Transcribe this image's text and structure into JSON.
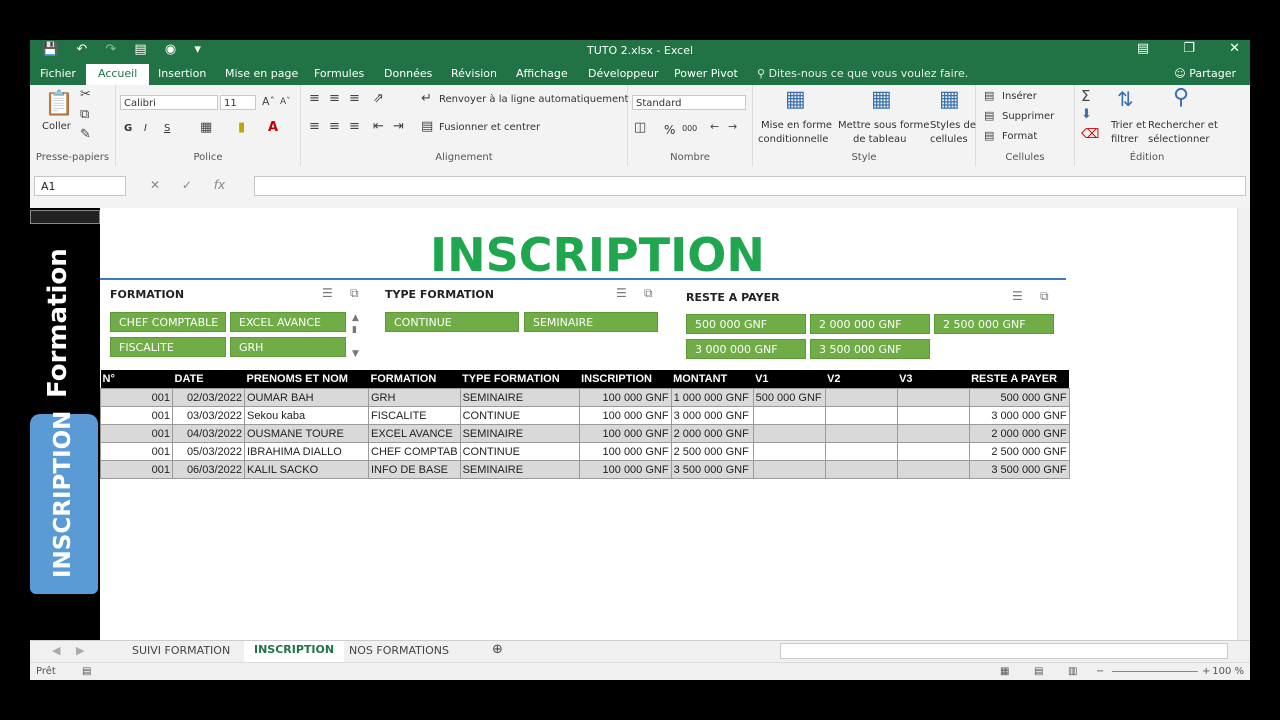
{
  "window": {
    "title": "TUTO 2.xlsx - Excel"
  },
  "ribbon_tabs": [
    "Fichier",
    "Accueil",
    "Insertion",
    "Mise en page",
    "Formules",
    "Données",
    "Révision",
    "Affichage",
    "Développeur",
    "Power Pivot"
  ],
  "tell_me": "Dites-nous ce que vous voulez faire.",
  "share": "Partager",
  "clipboard": {
    "paste": "Coller",
    "label": "Presse-papiers"
  },
  "font": {
    "name": "Calibri",
    "size": "11",
    "bold": "G",
    "italic": "I",
    "underline": "S",
    "label": "Police"
  },
  "alignment": {
    "wrap": "Renvoyer à la ligne automatiquement",
    "merge": "Fusionner et centrer",
    "label": "Alignement"
  },
  "number": {
    "format": "Standard",
    "percent": "%",
    "thousands": "000",
    "label": "Nombre"
  },
  "style": {
    "cond": "Mise en forme",
    "cond2": "conditionnelle",
    "table": "Mettre sous forme",
    "table2": "de tableau",
    "cell": "Styles de",
    "cell2": "cellules",
    "label": "Style"
  },
  "cells": {
    "insert": "Insérer",
    "delete": "Supprimer",
    "format": "Format",
    "label": "Cellules"
  },
  "editing": {
    "sort": "Trier et",
    "sort2": "filtrer",
    "find": "Rechercher et",
    "find2": "sélectionner",
    "label": "Édition"
  },
  "formula_bar": {
    "name_box": "A1",
    "fx": "fx"
  },
  "left_panel": {
    "formation": "Formation",
    "inscription_btn": "INSCRIPTION"
  },
  "sheet_title": "INSCRIPTION",
  "slicers": {
    "formation": {
      "title": "FORMATION",
      "items": [
        "CHEF COMPTABLE",
        "EXCEL AVANCE",
        "FISCALITE",
        "GRH"
      ]
    },
    "type_formation": {
      "title": "TYPE FORMATION",
      "items": [
        "CONTINUE",
        "SEMINAIRE"
      ]
    },
    "reste_a_payer": {
      "title": "RESTE A PAYER",
      "items": [
        "500 000 GNF",
        "2 000 000 GNF",
        "2 500 000 GNF",
        "3 000 000 GNF",
        "3 500 000 GNF"
      ]
    }
  },
  "table": {
    "headers": [
      "N°",
      "DATE",
      "PRENOMS ET NOM",
      "FORMATION",
      "TYPE FORMATION",
      "INSCRIPTION",
      "MONTANT",
      "V1",
      "V2",
      "V3",
      "RESTE A PAYER"
    ],
    "rows": [
      [
        "001",
        "02/03/2022",
        "OUMAR BAH",
        "GRH",
        "SEMINAIRE",
        "100 000 GNF",
        "1 000 000 GNF",
        "500 000 GNF",
        "",
        "",
        "500 000 GNF"
      ],
      [
        "001",
        "03/03/2022",
        "Sekou kaba",
        "FISCALITE",
        "CONTINUE",
        "100 000 GNF",
        "3 000 000 GNF",
        "",
        "",
        "",
        "3 000 000 GNF"
      ],
      [
        "001",
        "04/03/2022",
        "OUSMANE TOURE",
        "EXCEL AVANCE",
        "SEMINAIRE",
        "100 000 GNF",
        "2 000 000 GNF",
        "",
        "",
        "",
        "2 000 000 GNF"
      ],
      [
        "001",
        "05/03/2022",
        "IBRAHIMA DIALLO",
        "CHEF COMPTAB",
        "CONTINUE",
        "100 000 GNF",
        "2 500 000 GNF",
        "",
        "",
        "",
        "2 500 000 GNF"
      ],
      [
        "001",
        "06/03/2022",
        "KALIL SACKO",
        "INFO DE BASE",
        "SEMINAIRE",
        "100 000 GNF",
        "3 500 000 GNF",
        "",
        "",
        "",
        "3 500 000 GNF"
      ]
    ]
  },
  "sheet_tabs": [
    "SUIVI FORMATION",
    "INSCRIPTION",
    "NOS FORMATIONS"
  ],
  "status": {
    "ready": "Prêt",
    "zoom": "100 %"
  }
}
